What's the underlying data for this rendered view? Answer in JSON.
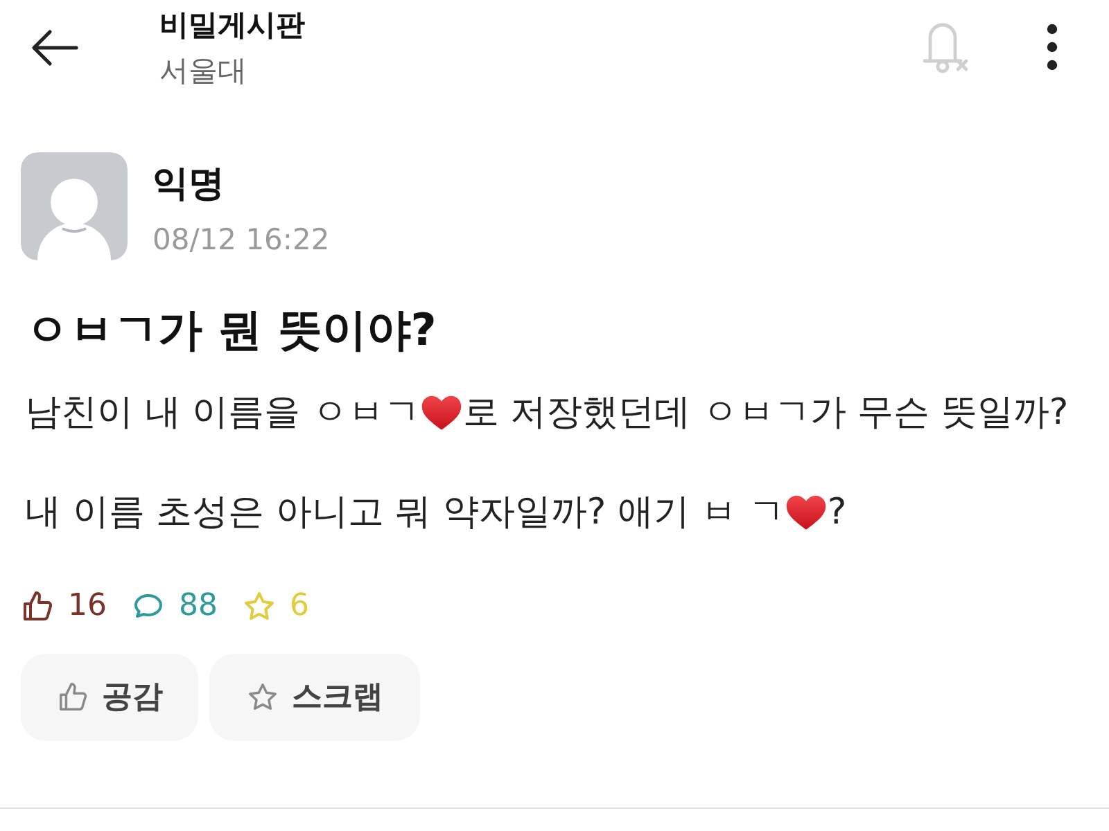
{
  "header": {
    "title": "비밀게시판",
    "subtitle": "서울대"
  },
  "post": {
    "author": "익명",
    "time": "08/12 16:22",
    "title": "ㅇㅂㄱ가 뭔 뜻이야?",
    "paragraphs": [
      {
        "parts": [
          {
            "kind": "text",
            "text": "남친이 내 이름을 ㅇㅂㄱ"
          },
          {
            "kind": "emoji"
          },
          {
            "kind": "text",
            "text": "로 저장했던데 ㅇㅂㄱ가 무슨 뜻일까?"
          }
        ]
      },
      {
        "parts": [
          {
            "kind": "text",
            "text": "내 이름 초성은 아니고 뭐 약자일까? 애기 ㅂ ㄱ"
          },
          {
            "kind": "emoji"
          },
          {
            "kind": "text",
            "text": "?"
          }
        ]
      }
    ]
  },
  "stats": [
    {
      "kind": "likes",
      "count": "16",
      "color": "#7a3328"
    },
    {
      "kind": "comments",
      "count": "88",
      "color": "#2f9a9c"
    },
    {
      "kind": "scraps",
      "count": "6",
      "color": "#e0cc3c"
    }
  ],
  "actions": [
    {
      "kind": "like",
      "label": "공감"
    },
    {
      "kind": "scrap",
      "label": "스크랩"
    }
  ]
}
